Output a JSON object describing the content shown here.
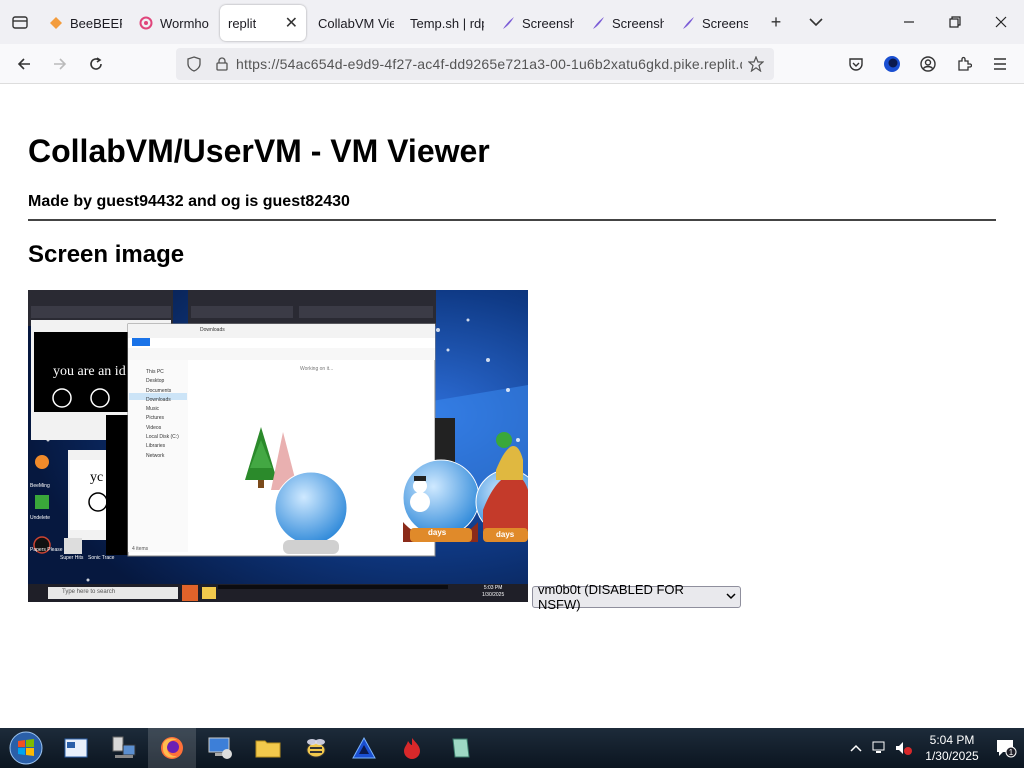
{
  "browser": {
    "tabs": [
      {
        "label": "BeeBEEP",
        "icon": "beebeep-icon",
        "active": false
      },
      {
        "label": "Wormho",
        "icon": "wormhole-icon",
        "active": false
      },
      {
        "label": "replit",
        "icon": "",
        "active": true
      },
      {
        "label": "CollabVM Vie",
        "icon": "",
        "active": false
      },
      {
        "label": "Temp.sh | rdp",
        "icon": "",
        "active": false
      },
      {
        "label": "Screensh",
        "icon": "feather-icon",
        "active": false
      },
      {
        "label": "Screensh",
        "icon": "feather-icon",
        "active": false
      },
      {
        "label": "Screensh",
        "icon": "feather-icon",
        "active": false
      }
    ],
    "url": "https://54ac654d-e9d9-4f27-ac4f-dd9265e721a3-00-1u6b2xatu6gkd.pike.replit.d",
    "accent": "#5b5bd6"
  },
  "page": {
    "title": "CollabVM/UserVM - VM Viewer",
    "credit": "Made by guest94432 and og is guest82430",
    "section_heading": "Screen image",
    "vm_select_value": "vm0b0t (DISABLED FOR NSFW)",
    "screen": {
      "idiot_text_1": "you are an id",
      "idiot_text_2": "yc",
      "explorer_breadcrumb": "Downloads",
      "explorer_loading": "Working on it...",
      "explorer_items": [
        "This PC",
        "Desktop",
        "Documents",
        "Downloads",
        "Music",
        "Pictures",
        "Videos",
        "Local Disk (C:)",
        "Libraries",
        "Network"
      ],
      "explorer_status": "4 items",
      "globe_label_1": "days",
      "globe_label_2": "days",
      "desktop_icons": [
        "BeeMing",
        "Undelete",
        "Papers Please",
        "Super Hits",
        "Sonic Trace"
      ],
      "vm_search": "Type here to search",
      "vm_time": "5:03 PM",
      "vm_date": "1/30/2025"
    }
  },
  "taskbar": {
    "time": "5:04 PM",
    "date": "1/30/2025",
    "notification_count": "1"
  }
}
